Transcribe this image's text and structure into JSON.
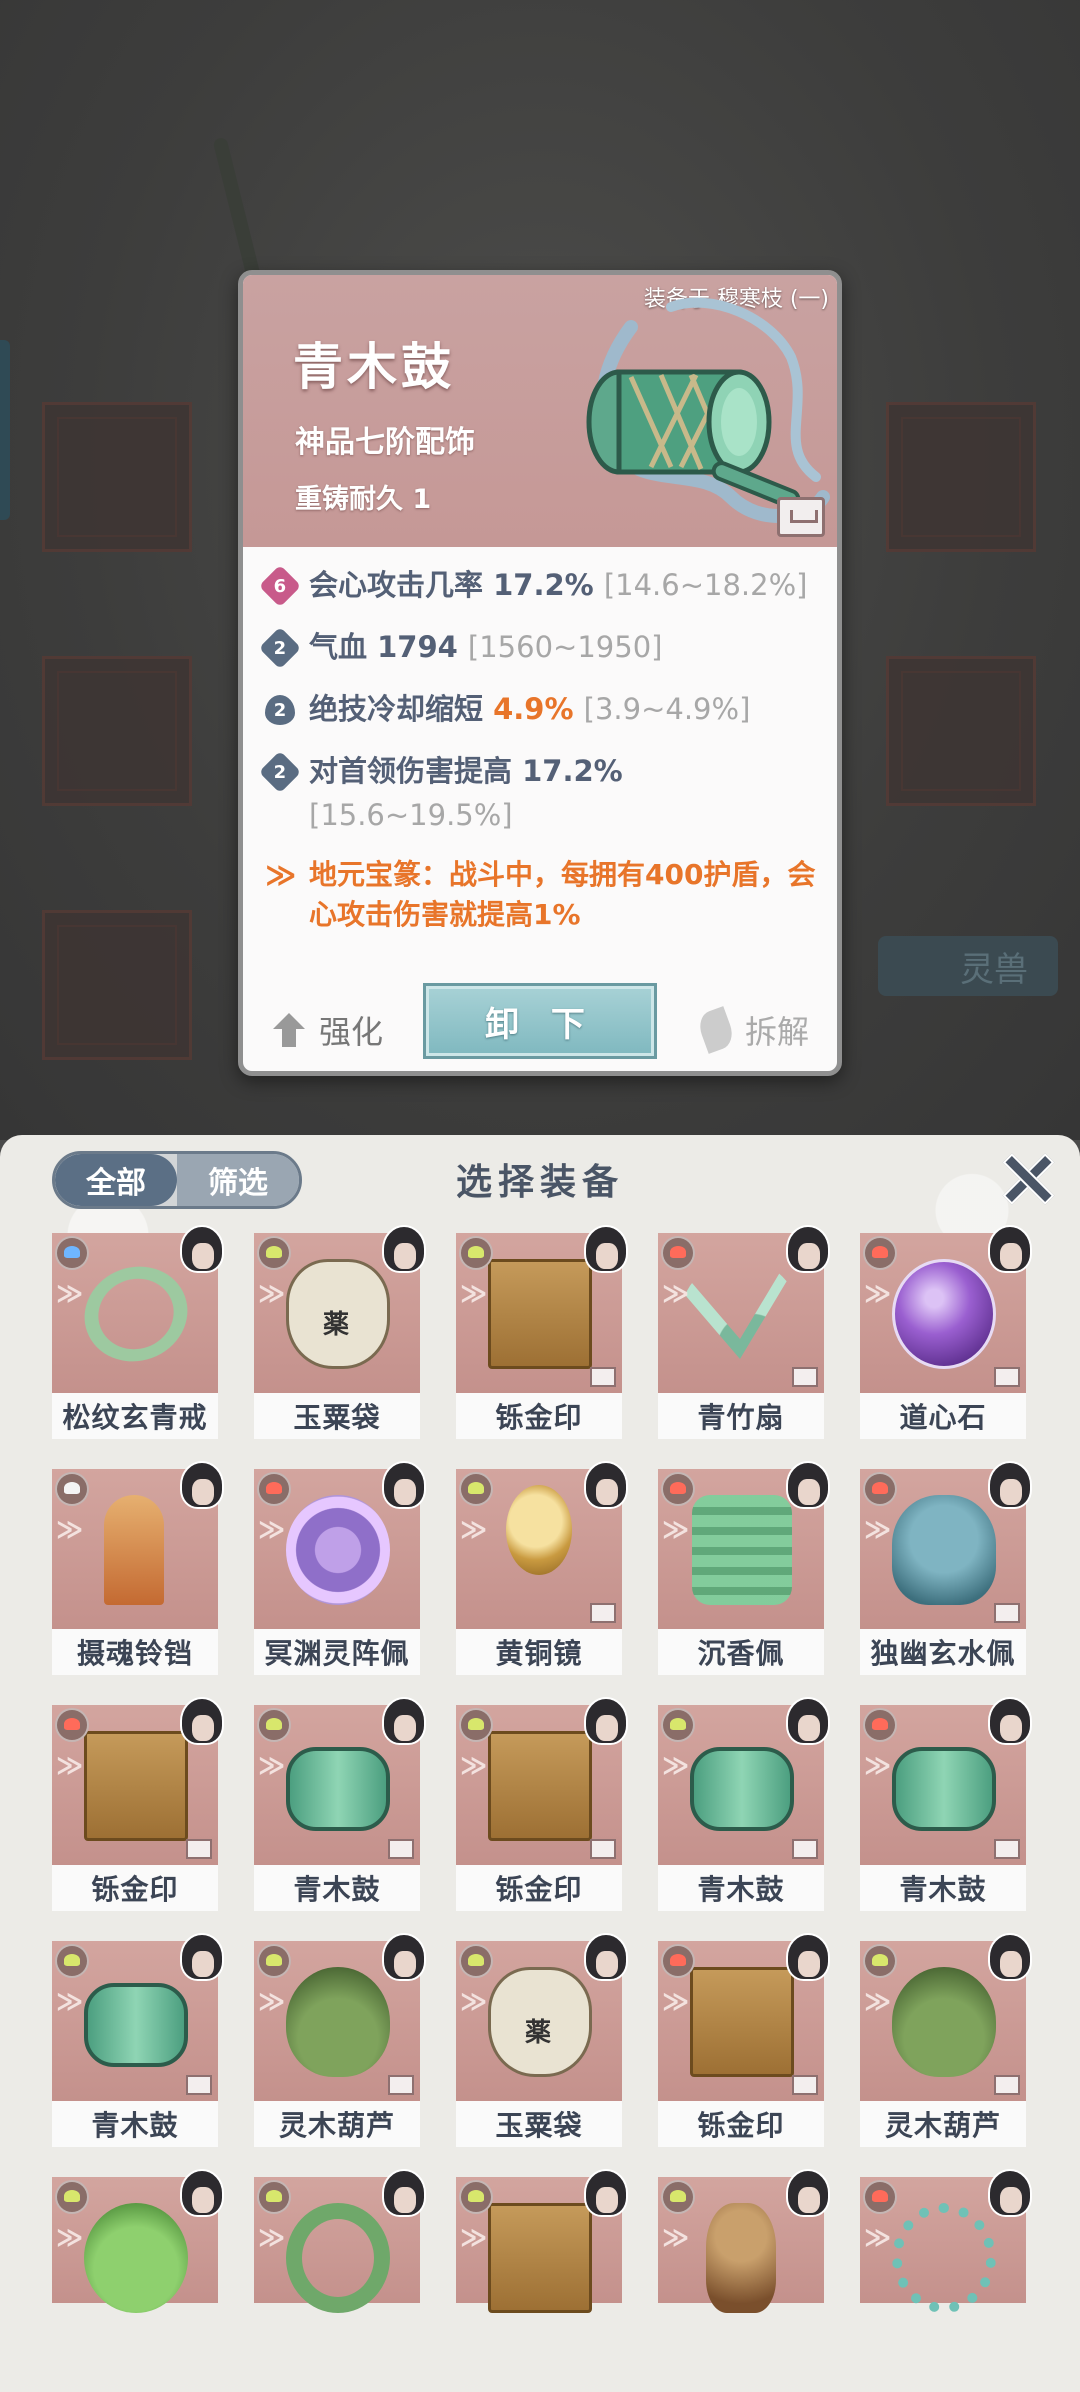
{
  "detail": {
    "equipped_on": "装备于 穆寒枝 (一)",
    "name": "青木鼓",
    "grade": "神品七阶配饰",
    "reforge": "重铸耐久 1",
    "stats": [
      {
        "badge": "6",
        "text": "会心攻击几率 17.2%",
        "range": "[14.6~18.2%]"
      },
      {
        "badge": "2",
        "text": "气血 1794",
        "range": "[1560~1950]"
      },
      {
        "badge": "2",
        "label": "绝技冷却缩短 ",
        "highlight": "4.9%",
        "range": "[3.9~4.9%]"
      },
      {
        "badge": "2",
        "text": "对首领伤害提高 17.2%",
        "range": "[15.6~19.5%]"
      }
    ],
    "set_effect": "地元宝篆：战斗中，每拥有400护盾，会心攻击伤害就提高1%",
    "actions": {
      "strengthen": "强化",
      "unequip": "卸 下",
      "dismantle": "拆解"
    },
    "accent_color": "#e8752a"
  },
  "background": {
    "tab_label": "灵兽"
  },
  "panel": {
    "title": "选择装备",
    "segments": {
      "all": "全部",
      "filter": "筛选"
    },
    "items": [
      {
        "name": "松纹玄青戒",
        "element": "water",
        "art": "ring"
      },
      {
        "name": "玉粟袋",
        "element": "wind",
        "art": "bag"
      },
      {
        "name": "铄金印",
        "element": "wind",
        "art": "seal"
      },
      {
        "name": "青竹扇",
        "element": "fire",
        "art": "fan"
      },
      {
        "name": "道心石",
        "element": "fire",
        "art": "orb"
      },
      {
        "name": "摄魂铃铛",
        "element": "white",
        "art": "bell"
      },
      {
        "name": "冥渊灵阵佩",
        "element": "fire",
        "art": "wheel"
      },
      {
        "name": "黄铜镜",
        "element": "wind",
        "art": "mirror"
      },
      {
        "name": "沉香佩",
        "element": "fire",
        "art": "pendant"
      },
      {
        "name": "独幽玄水佩",
        "element": "fire",
        "art": "censer"
      },
      {
        "name": "铄金印",
        "element": "fire",
        "art": "seal"
      },
      {
        "name": "青木鼓",
        "element": "wind",
        "art": "drum"
      },
      {
        "name": "铄金印",
        "element": "wind",
        "art": "seal"
      },
      {
        "name": "青木鼓",
        "element": "wind",
        "art": "drum"
      },
      {
        "name": "青木鼓",
        "element": "fire",
        "art": "drum"
      },
      {
        "name": "青木鼓",
        "element": "wind",
        "art": "drum"
      },
      {
        "name": "灵木葫芦",
        "element": "wind",
        "art": "gourd"
      },
      {
        "name": "玉粟袋",
        "element": "wind",
        "art": "bag"
      },
      {
        "name": "铄金印",
        "element": "fire",
        "art": "seal"
      },
      {
        "name": "灵木葫芦",
        "element": "wind",
        "art": "gourd"
      },
      {
        "name": "",
        "element": "wind",
        "art": "gourd2"
      },
      {
        "name": "",
        "element": "wind",
        "art": "jade"
      },
      {
        "name": "",
        "element": "wind",
        "art": "seal"
      },
      {
        "name": "",
        "element": "wind",
        "art": "stone"
      },
      {
        "name": "",
        "element": "fire",
        "art": "chain"
      }
    ]
  }
}
